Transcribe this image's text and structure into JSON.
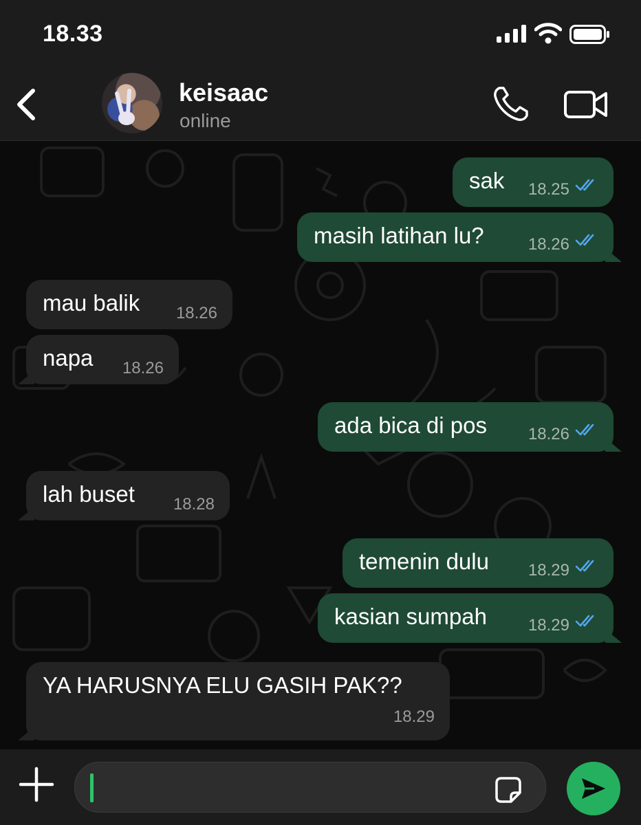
{
  "status_bar": {
    "time": "18.33"
  },
  "header": {
    "contact_name": "keisaac",
    "contact_status": "online"
  },
  "messages": [
    {
      "direction": "out",
      "text": "sak",
      "time": "18.25",
      "read": true
    },
    {
      "direction": "out",
      "text": "masih latihan lu?",
      "time": "18.26",
      "read": true
    },
    {
      "direction": "in",
      "text": "mau balik",
      "time": "18.26"
    },
    {
      "direction": "in",
      "text": "napa",
      "time": "18.26"
    },
    {
      "direction": "out",
      "text": "ada bica di pos",
      "time": "18.26",
      "read": true
    },
    {
      "direction": "in",
      "text": "lah buset",
      "time": "18.28"
    },
    {
      "direction": "out",
      "text": "temenin dulu",
      "time": "18.29",
      "read": true
    },
    {
      "direction": "out",
      "text": "kasian sumpah",
      "time": "18.29",
      "read": true
    },
    {
      "direction": "in",
      "text": "YA HARUSNYA ELU GASIH PAK??",
      "time": "18.29"
    }
  ],
  "input": {
    "value": "",
    "placeholder": ""
  },
  "icons": {
    "back": "chevron-left-icon",
    "call": "phone-icon",
    "video": "video-camera-icon",
    "plus": "plus-icon",
    "sticker": "sticker-icon",
    "send": "send-icon",
    "read_receipt": "double-check-icon"
  },
  "colors": {
    "outgoing_bubble": "#1f4a35",
    "incoming_bubble": "#232323",
    "read_tick": "#53a6f0",
    "send_button": "#25b05f",
    "background": "#0b0b0b"
  }
}
